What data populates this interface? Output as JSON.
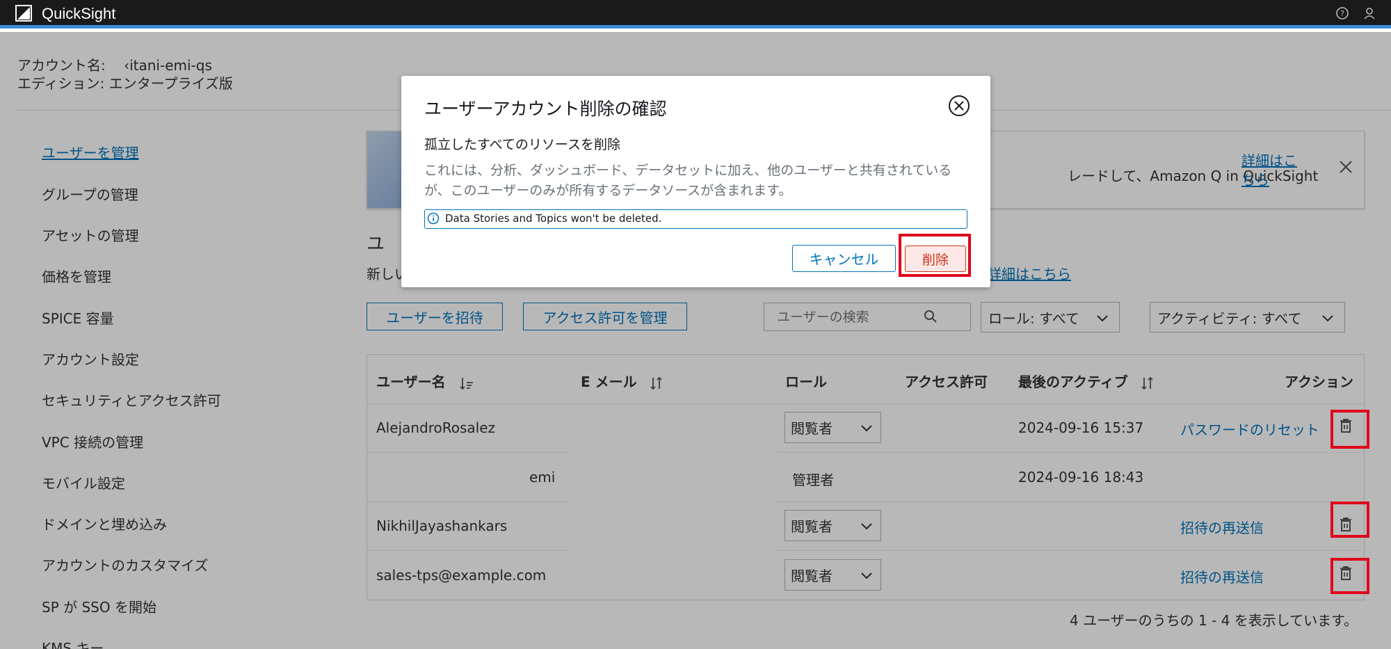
{
  "topbar": {
    "app_title": "QuickSight",
    "logo_icon": "quicksight-logo-icon",
    "help_icon": "help-icon",
    "user_icon": "user-icon"
  },
  "account": {
    "name_line": "アカウント名:　 ‹itani-emi-qs",
    "edition_line": "エディション: エンタープライズ版"
  },
  "sidebar": {
    "items": [
      {
        "label": "ユーザーを管理",
        "active": true
      },
      {
        "label": "グループの管理"
      },
      {
        "label": "アセットの管理"
      },
      {
        "label": "価格を管理"
      },
      {
        "label": "SPICE 容量"
      },
      {
        "label": "アカウント設定"
      },
      {
        "label": "セキュリティとアクセス許可"
      },
      {
        "label": "VPC 接続の管理"
      },
      {
        "label": "モバイル設定"
      },
      {
        "label": "ドメインと埋め込み"
      },
      {
        "label": "アカウントのカスタマイズ"
      },
      {
        "label": "SP が SSO を開始"
      },
      {
        "label": "KMS キー"
      }
    ]
  },
  "banner": {
    "text": "レードして、Amazon Q in QuickSight",
    "link": "詳細はこちら",
    "close_icon": "close-icon"
  },
  "section": {
    "title": "ユ",
    "subtitle": "新しい",
    "link": "詳細はこちら"
  },
  "toolbar": {
    "invite_label": "ユーザーを招待",
    "permissions_label": "アクセス許可を管理",
    "search_placeholder": "ユーザーの検索",
    "role_filter": "ロール: すべて",
    "activity_filter": "アクティビティ: すべて"
  },
  "table": {
    "headers": {
      "username": "ユーザー名",
      "email": "E メール",
      "role": "ロール",
      "access": "アクセス許可",
      "last_active": "最後のアクティブ",
      "actions": "アクション"
    },
    "rows": [
      {
        "username": "AlejandroRosalez",
        "role": "閲覧者",
        "role_editable": true,
        "last_active": "2024-09-16 15:37",
        "action": "パスワードのリセット"
      },
      {
        "username": "emi",
        "role": "管理者",
        "role_editable": false,
        "last_active": "2024-09-16 18:43",
        "action": ""
      },
      {
        "username": "NikhilJayashankars",
        "role": "閲覧者",
        "role_editable": true,
        "last_active": "",
        "action": "招待の再送信"
      },
      {
        "username": "sales-tps@example.com",
        "role": "閲覧者",
        "role_editable": true,
        "last_active": "",
        "action": "招待の再送信"
      }
    ],
    "footer": "4 ユーザーのうちの 1 - 4 を表示しています。"
  },
  "modal": {
    "title": "ユーザーアカウント削除の確認",
    "subtitle": "孤立したすべてのリソースを削除",
    "description": "これには、分析、ダッシュボード、データセットに加え、他のユーザーと共有されているが、このユーザーのみが所有するデータソースが含まれます。",
    "info": "Data Stories and Topics won't be deleted.",
    "cancel_label": "キャンセル",
    "delete_label": "削除"
  },
  "colors": {
    "accent": "#0073bb",
    "danger": "#d13212",
    "highlight": "#e0001a",
    "topbar": "#1a1a1a"
  }
}
